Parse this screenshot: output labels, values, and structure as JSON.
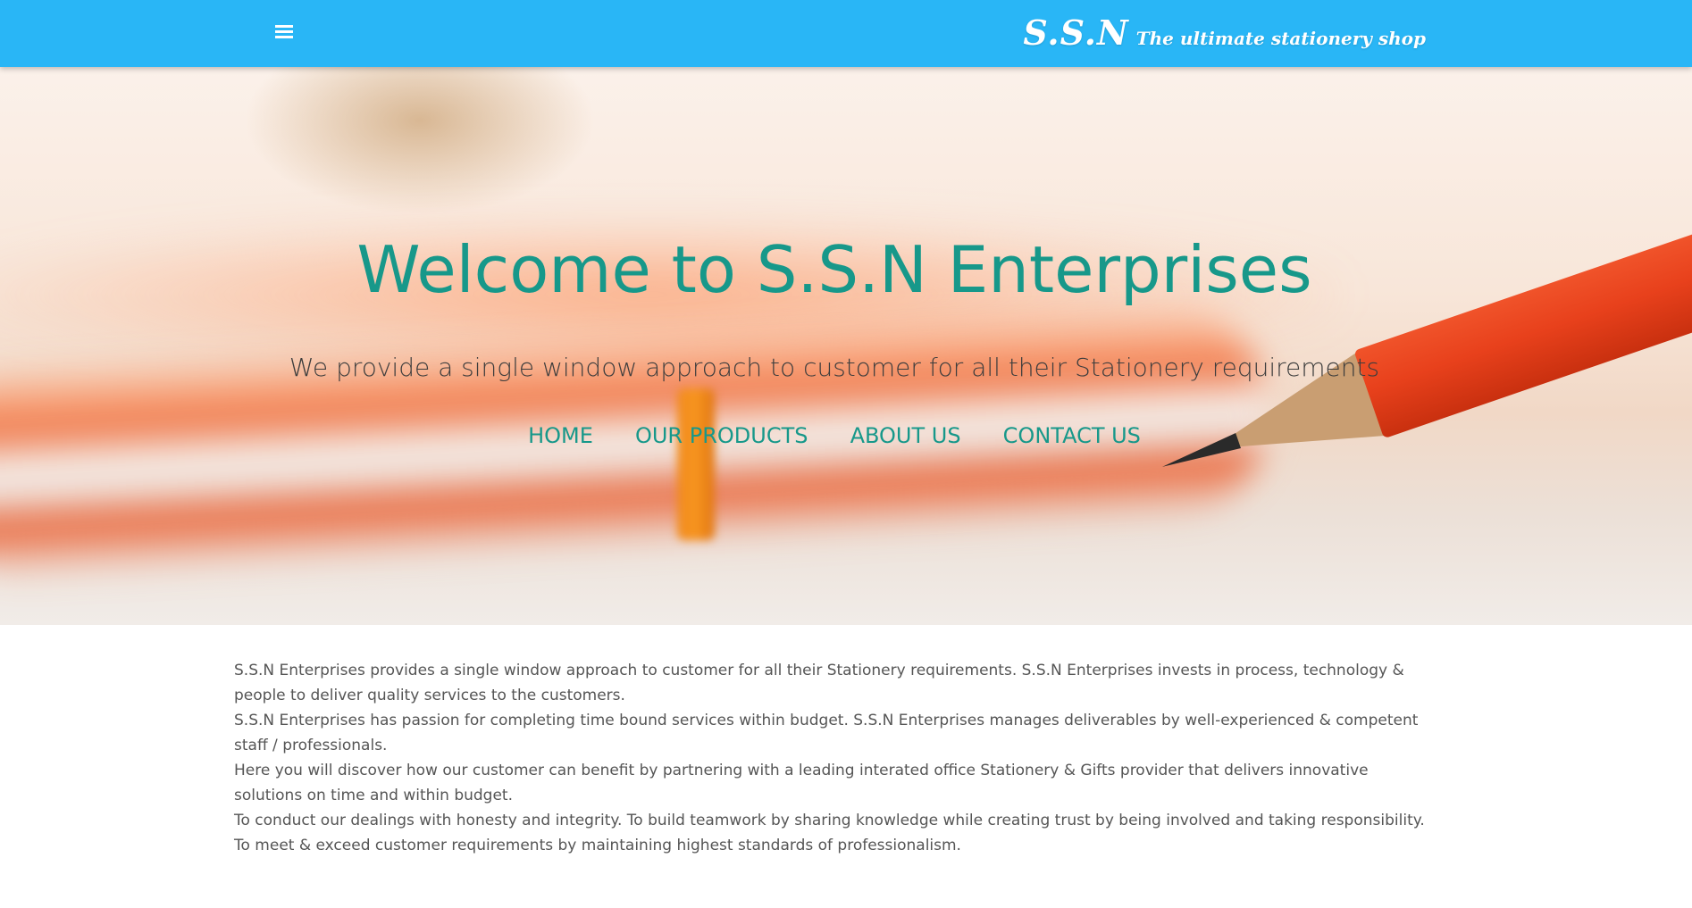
{
  "navbar": {
    "menu_icon": "hamburger-menu-icon",
    "brand_logo": "S.S.N",
    "brand_tagline": "The ultimate stationery shop",
    "background_color": "#29b6f6"
  },
  "hero": {
    "title": "Welcome to S.S.N Enterprises",
    "subtitle": "We provide a single window approach to customer for all their Stationery requirements",
    "accent_color": "#17988a",
    "nav_links": [
      {
        "label": "HOME"
      },
      {
        "label": "OUR PRODUCTS"
      },
      {
        "label": "ABOUT US"
      },
      {
        "label": "CONTACT US"
      }
    ]
  },
  "about": {
    "paragraphs": [
      "S.S.N Enterprises provides a single window approach to customer for all their Stationery requirements. S.S.N Enterprises invests in process, technology & people to deliver quality services to the customers.",
      "S.S.N Enterprises has passion for completing time bound services within budget. S.S.N Enterprises manages deliverables by well-experienced & competent staff / professionals.",
      "Here you will discover how our customer can benefit by partnering with a leading interated office Stationery & Gifts provider that delivers innovative solutions on time and within budget.",
      "To conduct our dealings with honesty and integrity. To build teamwork by sharing knowledge while creating trust by being involved and taking responsibility. To meet & exceed customer requirements by maintaining highest standards of professionalism."
    ]
  }
}
